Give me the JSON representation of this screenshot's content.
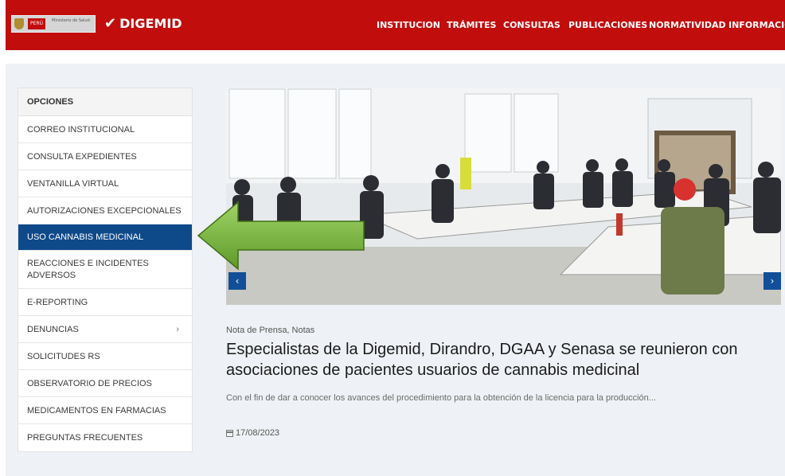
{
  "header": {
    "gov_flag": "PERÚ",
    "gov_ministry": "Ministerio de Salud",
    "brand": "DIGEMID",
    "nav": [
      "INSTITUCION",
      "TRÁMITES",
      "CONSULTAS",
      "PUBLICACIONES",
      "NORMATIVIDAD",
      "INFORMACIÓN"
    ],
    "bar_color": "#c20d0d"
  },
  "sidebar": {
    "title": "OPCIONES",
    "items": [
      {
        "label": "CORREO INSTITUCIONAL"
      },
      {
        "label": "CONSULTA EXPEDIENTES"
      },
      {
        "label": "VENTANILLA VIRTUAL"
      },
      {
        "label": "AUTORIZACIONES EXCEPCIONALES"
      },
      {
        "label": "USO CANNABIS MEDICINAL",
        "active": true
      },
      {
        "label": "REACCIONES E INCIDENTES ADVERSOS"
      },
      {
        "label": "E-REPORTING"
      },
      {
        "label": "DENUNCIAS",
        "submenu": true
      },
      {
        "label": "SOLICITUDES RS"
      },
      {
        "label": "OBSERVATORIO DE PRECIOS"
      },
      {
        "label": "MEDICAMENTOS EN FARMACIAS"
      },
      {
        "label": "PREGUNTAS FRECUENTES"
      }
    ],
    "active_color": "#0e4a8a"
  },
  "slider": {
    "prev_icon": "chevron-left-icon",
    "next_icon": "chevron-right-icon",
    "prev_glyph": "‹",
    "next_glyph": "›",
    "arrow_annotation_color": "#7cc043"
  },
  "article": {
    "categories": "Nota de Prensa, Notas",
    "title": "Especialistas de la Digemid, Dirandro, DGAA y Senasa se reunieron con asociaciones de pacientes usuarios de cannabis medicinal",
    "excerpt": "Con el fin de dar a conocer los avances del procedimiento para la obtención de la licencia para la producción...",
    "date": "17/08/2023"
  }
}
